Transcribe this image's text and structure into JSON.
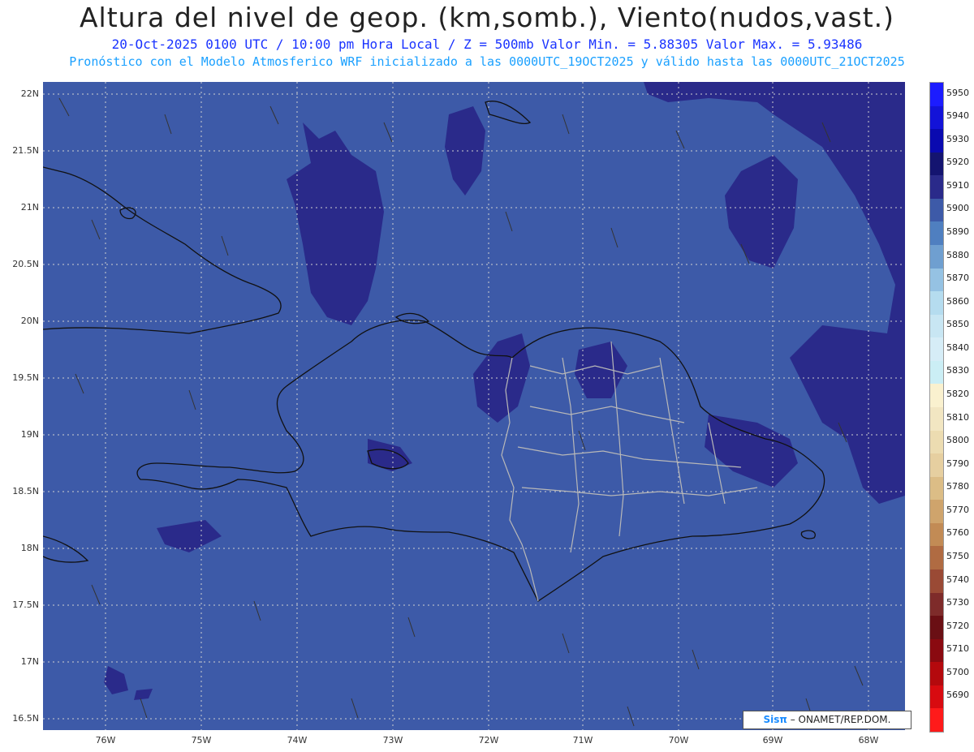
{
  "header": {
    "title": "Altura del nivel de geop. (km,somb.), Viento(nudos,vast.)",
    "subtitle_1": "20-Oct-2025  0100 UTC / 10:00 pm Hora Local / Z = 500mb    Valor Min. = 5.88305  Valor Max. = 5.93486",
    "subtitle_2": "Pronóstico con el Modelo Atmosferico WRF inicializado a las 0000UTC_19OCT2025 y válido hasta las  0000UTC_21OCT2025"
  },
  "map": {
    "lat_labels": [
      "22N",
      "21.5N",
      "21N",
      "20.5N",
      "20N",
      "19.5N",
      "19N",
      "18.5N",
      "18N",
      "17.5N",
      "17N",
      "16.5N"
    ],
    "lon_labels": [
      "76W",
      "75W",
      "74W",
      "73W",
      "72W",
      "71W",
      "70W",
      "69W",
      "68W"
    ],
    "field_color": "#3d5aa8",
    "high_color": "#2a2a8a",
    "coast_color": "#111111",
    "border_color": "#b8b8b8"
  },
  "colorbar": {
    "levels": [
      "5950",
      "5940",
      "5930",
      "5920",
      "5910",
      "5900",
      "5890",
      "5880",
      "5870",
      "5860",
      "5850",
      "5840",
      "5830",
      "5820",
      "5810",
      "5800",
      "5790",
      "5780",
      "5770",
      "5760",
      "5750",
      "5740",
      "5730",
      "5720",
      "5710",
      "5700",
      "5690"
    ],
    "colors": [
      "#1c1cff",
      "#1313d8",
      "#0a0ab0",
      "#141470",
      "#2a2a8a",
      "#3d5aa8",
      "#4f7fc0",
      "#6f9fd0",
      "#95c2e3",
      "#b5dcef",
      "#c8e6f3",
      "#d6edf7",
      "#cbeef5",
      "#faf1cf",
      "#f2e6c2",
      "#ecdcb1",
      "#e6cfa0",
      "#dcbd86",
      "#cfa46c",
      "#c28b55",
      "#b06b42",
      "#9a4a35",
      "#7e2b2a",
      "#6a0f14",
      "#8a0a10",
      "#b4090d",
      "#d80b10",
      "#ff1a1a"
    ]
  },
  "credit": {
    "brand": "Sisπ",
    "text": " – ONAMET/REP.DOM."
  }
}
